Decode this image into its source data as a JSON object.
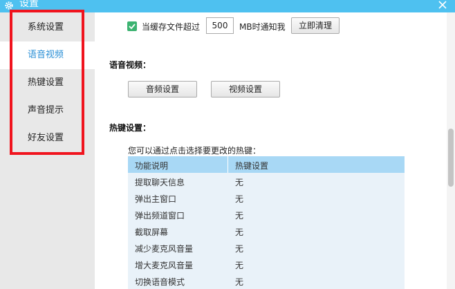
{
  "window": {
    "title": "设置",
    "icons": {
      "settings": "gear-icon",
      "close": "close-icon"
    }
  },
  "sidebar": {
    "items": [
      {
        "label": "系统设置",
        "active": false
      },
      {
        "label": "语音视频",
        "active": true
      },
      {
        "label": "热键设置",
        "active": false
      },
      {
        "label": "声音提示",
        "active": false
      },
      {
        "label": "好友设置",
        "active": false
      }
    ]
  },
  "cache": {
    "checked": true,
    "label_before": "当缓存文件超过",
    "value": "500",
    "label_after": "MB时通知我",
    "clear_button": "立即清理"
  },
  "voice_video": {
    "title": "语音视频：",
    "audio_button": "音频设置",
    "video_button": "视频设置"
  },
  "hotkeys": {
    "title": "热键设置：",
    "hint": "您可以通过点击选择要更改的热键：",
    "columns": [
      "功能说明",
      "热键设置"
    ],
    "rows": [
      [
        "提取聊天信息",
        "无"
      ],
      [
        "弹出主窗口",
        "无"
      ],
      [
        "弹出频道窗口",
        "无"
      ],
      [
        "截取屏幕",
        "无"
      ],
      [
        "减少麦克风音量",
        "无"
      ],
      [
        "增大麦克风音量",
        "无"
      ],
      [
        "切换语音模式",
        "无"
      ]
    ]
  },
  "colors": {
    "titlebar": "#4ec1f0",
    "active_item_text": "#2a8fd6",
    "highlight_box": "#f0141e",
    "table_header": "#a8d8f5",
    "table_body": "#e9f2f9",
    "checkbox": "#3cb371"
  }
}
